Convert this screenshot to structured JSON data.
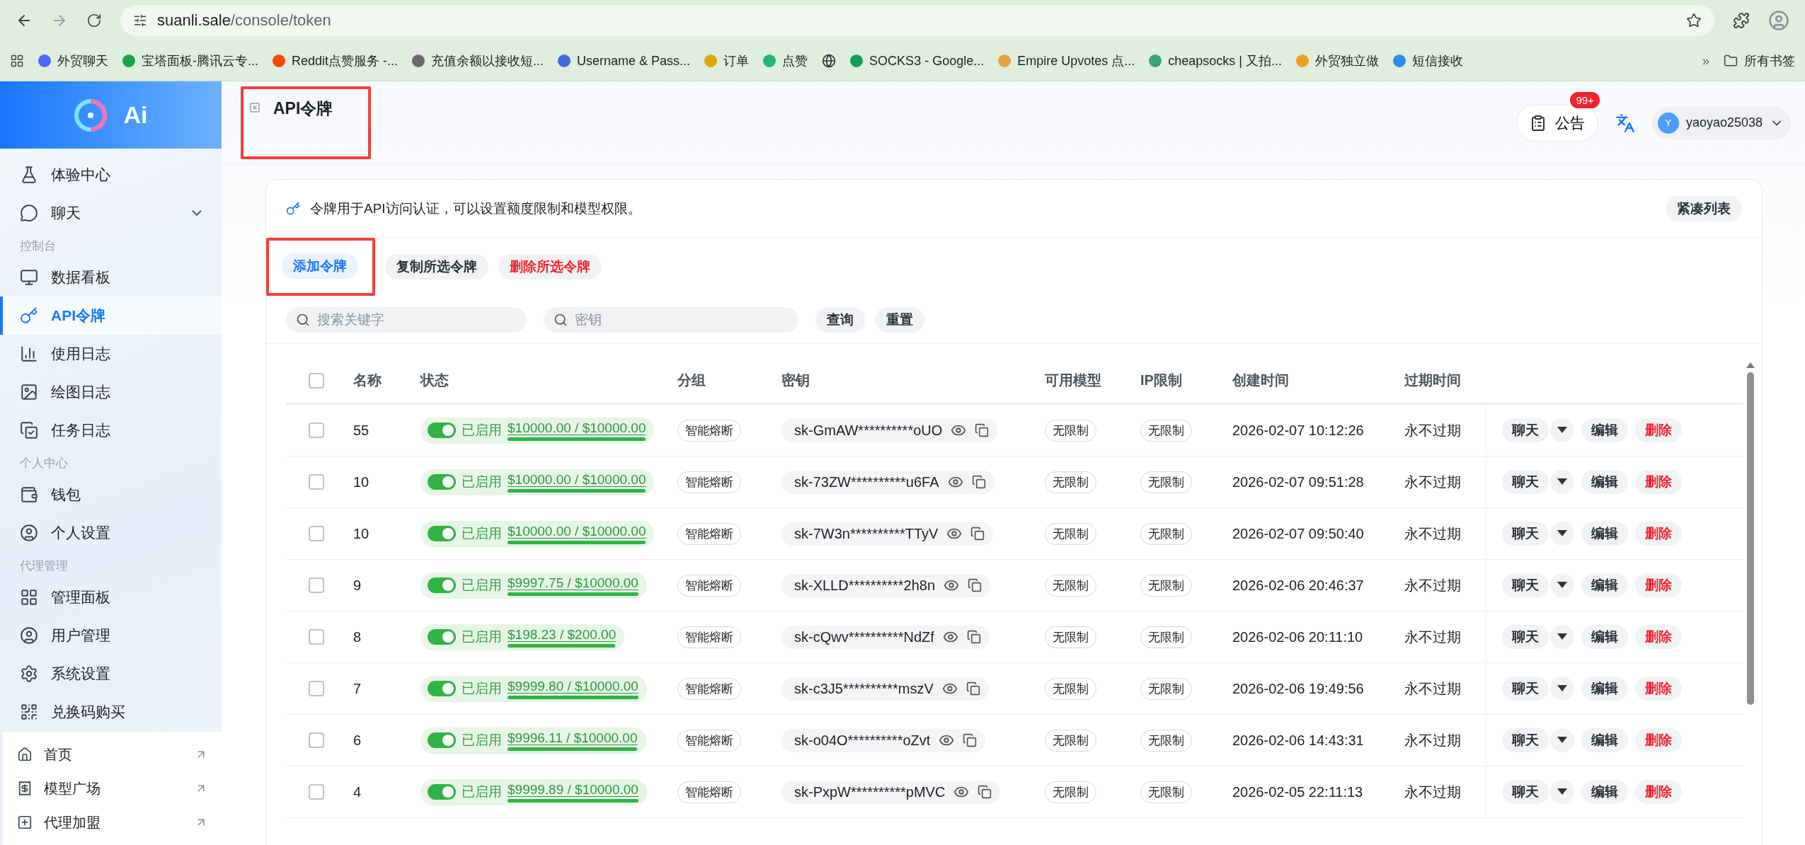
{
  "browser": {
    "url_host": "suanli.sale",
    "url_path": "/console/token",
    "bookmarks": [
      {
        "kind": "link",
        "label": "外贸聊天"
      },
      {
        "kind": "link",
        "label": "宝塔面板-腾讯云专..."
      },
      {
        "kind": "link",
        "label": "Reddit点赞服务 -..."
      },
      {
        "kind": "link",
        "label": "充值余额以接收短..."
      },
      {
        "kind": "link",
        "label": "Username & Pass..."
      },
      {
        "kind": "link",
        "label": "订单"
      },
      {
        "kind": "link",
        "label": "点赞"
      },
      {
        "kind": "icon"
      },
      {
        "kind": "link",
        "label": "SOCKS3 - Google..."
      },
      {
        "kind": "link",
        "label": "Empire Upvotes 点..."
      },
      {
        "kind": "link",
        "label": "cheapsocks | 又拍..."
      },
      {
        "kind": "link",
        "label": "外贸独立做"
      },
      {
        "kind": "link",
        "label": "短信接收"
      }
    ],
    "more": "»",
    "all_bookmarks": "所有书签"
  },
  "sidebar": {
    "logo_text": "Ai",
    "sections": [
      {
        "items": [
          {
            "label": "体验中心",
            "selected": false
          },
          {
            "label": "聊天",
            "selected": false,
            "expanded": false
          }
        ]
      },
      {
        "heading": "控制台",
        "items": [
          {
            "label": "数据看板",
            "selected": false
          },
          {
            "label": "API令牌",
            "selected": true
          },
          {
            "label": "使用日志",
            "selected": false
          },
          {
            "label": "绘图日志",
            "selected": false
          },
          {
            "label": "任务日志",
            "selected": false
          }
        ]
      },
      {
        "heading": "个人中心",
        "items": [
          {
            "label": "钱包",
            "selected": false
          },
          {
            "label": "个人设置",
            "selected": false
          }
        ]
      },
      {
        "heading": "代理管理",
        "items": [
          {
            "label": "管理面板",
            "selected": false
          },
          {
            "label": "用户管理",
            "selected": false
          },
          {
            "label": "系统设置",
            "selected": false
          },
          {
            "label": "兑换码购买",
            "selected": false
          }
        ]
      }
    ],
    "footer_links": [
      "首页",
      "模型广场",
      "代理加盟"
    ]
  },
  "header": {
    "title": "API令牌",
    "notice": "公告",
    "notice_badge": "99+",
    "user_initial": "Y",
    "username": "yaoyao25038"
  },
  "card": {
    "description": "令牌用于API访问认证，可以设置额度限制和模型权限。",
    "compact_button": "紧凑列表",
    "actions": [
      {
        "label": "添加令牌",
        "kind": "primary"
      },
      {
        "label": "复制所选令牌",
        "kind": "default"
      },
      {
        "label": "删除所选令牌",
        "kind": "danger"
      }
    ],
    "search_placeholder": "搜索关键字",
    "key_placeholder": "密钥",
    "query_button": "查询",
    "reset_button": "重置",
    "table": {
      "all_checked": false,
      "columns": [
        "名称",
        "状态",
        "分组",
        "密钥",
        "可用模型",
        "IP限制",
        "创建时间",
        "过期时间"
      ],
      "rows": [
        {
          "checked": false,
          "name": "55",
          "on": true,
          "status": "已启用",
          "quota": "$10000.00 / $10000.00",
          "level": 1,
          "group": "智能熔断",
          "key": "sk-GmAW**********oUO",
          "models": "无限制",
          "ip": "无限制",
          "created": "2026-02-07 10:12:26",
          "expires": "永不过期",
          "actions": [
            "聊天",
            "编辑",
            "删除"
          ]
        },
        {
          "checked": false,
          "name": "10",
          "on": true,
          "status": "已启用",
          "quota": "$10000.00 / $10000.00",
          "level": 1,
          "group": "智能熔断",
          "key": "sk-73ZW**********u6FA",
          "models": "无限制",
          "ip": "无限制",
          "created": "2026-02-07 09:51:28",
          "expires": "永不过期",
          "actions": [
            "聊天",
            "编辑",
            "删除"
          ]
        },
        {
          "checked": false,
          "name": "10",
          "on": true,
          "status": "已启用",
          "quota": "$10000.00 / $10000.00",
          "level": 1,
          "group": "智能熔断",
          "key": "sk-7W3n**********TTyV",
          "models": "无限制",
          "ip": "无限制",
          "created": "2026-02-07 09:50:40",
          "expires": "永不过期",
          "actions": [
            "聊天",
            "编辑",
            "删除"
          ]
        },
        {
          "checked": false,
          "name": "9",
          "on": true,
          "status": "已启用",
          "quota": "$9997.75 / $10000.00",
          "level": 0.9998,
          "group": "智能熔断",
          "key": "sk-XLLD**********2h8n",
          "models": "无限制",
          "ip": "无限制",
          "created": "2026-02-06 20:46:37",
          "expires": "永不过期",
          "actions": [
            "聊天",
            "编辑",
            "删除"
          ]
        },
        {
          "checked": false,
          "name": "8",
          "on": true,
          "status": "已启用",
          "quota": "$198.23 / $200.00",
          "level": 0.9912,
          "group": "智能熔断",
          "key": "sk-cQwv**********NdZf",
          "models": "无限制",
          "ip": "无限制",
          "created": "2026-02-06 20:11:10",
          "expires": "永不过期",
          "actions": [
            "聊天",
            "编辑",
            "删除"
          ]
        },
        {
          "checked": false,
          "name": "7",
          "on": true,
          "status": "已启用",
          "quota": "$9999.80 / $10000.00",
          "level": 0.9999,
          "group": "智能熔断",
          "key": "sk-c3J5**********mszV",
          "models": "无限制",
          "ip": "无限制",
          "created": "2026-02-06 19:49:56",
          "expires": "永不过期",
          "actions": [
            "聊天",
            "编辑",
            "删除"
          ]
        },
        {
          "checked": false,
          "name": "6",
          "on": true,
          "status": "已启用",
          "quota": "$9996.11 / $10000.00",
          "level": 0.9996,
          "group": "智能熔断",
          "key": "sk-o04O**********oZvt",
          "models": "无限制",
          "ip": "无限制",
          "created": "2026-02-06 14:43:31",
          "expires": "永不过期",
          "actions": [
            "聊天",
            "编辑",
            "删除"
          ]
        },
        {
          "checked": false,
          "name": "4",
          "on": true,
          "status": "已启用",
          "quota": "$9999.89 / $10000.00",
          "level": 0.9999,
          "group": "智能熔断",
          "key": "sk-PxpW**********pMVC",
          "models": "无限制",
          "ip": "无限制",
          "created": "2026-02-05 22:11:13",
          "expires": "永不过期",
          "actions": [
            "聊天",
            "编辑",
            "删除"
          ]
        }
      ]
    }
  }
}
